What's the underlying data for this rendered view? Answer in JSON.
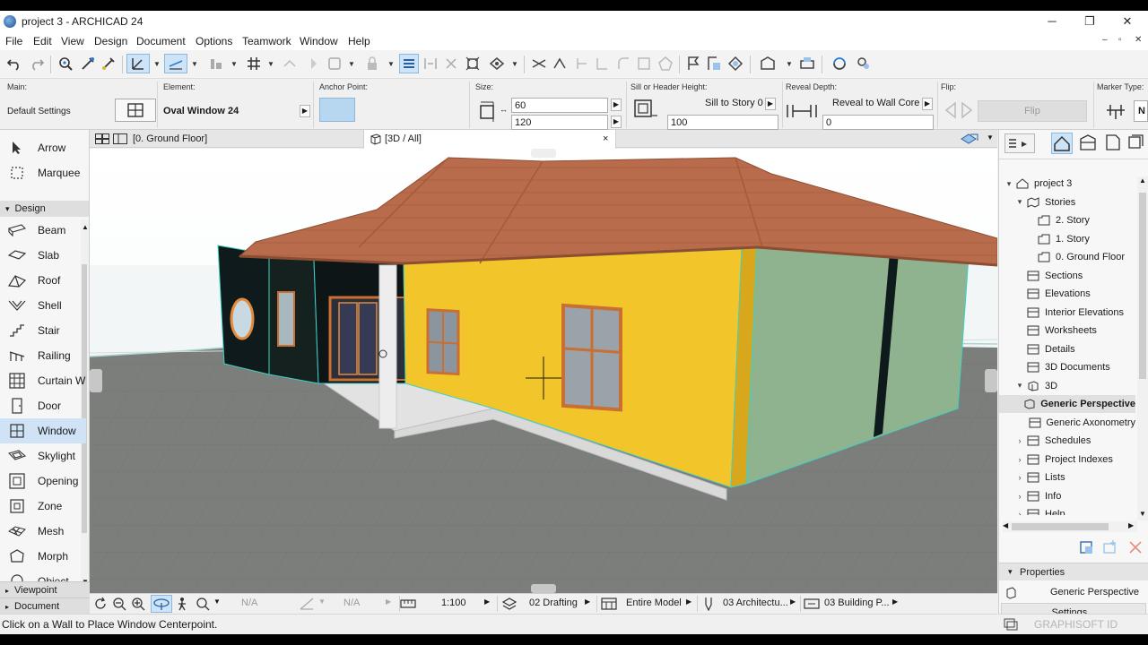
{
  "window": {
    "title": "project 3 - ARCHICAD 24",
    "controls": [
      "minimize",
      "restore",
      "close"
    ]
  },
  "menu": [
    "File",
    "Edit",
    "View",
    "Design",
    "Document",
    "Options",
    "Teamwork",
    "Window",
    "Help"
  ],
  "infobox": {
    "main_label": "Main:",
    "main_value": "Default Settings",
    "element_label": "Element:",
    "element_value": "Oval Window 24",
    "anchor_label": "Anchor Point:",
    "size_label": "Size:",
    "size_width": "60",
    "size_height": "120",
    "sill_label": "Sill or Header Height:",
    "sill_mode": "Sill to Story 0",
    "sill_value": "100",
    "reveal_label": "Reveal Depth:",
    "reveal_mode": "Reveal to Wall Core",
    "reveal_value": "0",
    "flip_label": "Flip:",
    "flip_button": "Flip",
    "marker_label": "Marker Type:",
    "marker_value": "N"
  },
  "tabs": [
    {
      "label": "[0. Ground Floor]"
    },
    {
      "label": "[3D / All]",
      "close": "×"
    }
  ],
  "toolbox": {
    "top_tools": [
      {
        "name": "arrow",
        "label": "Arrow"
      },
      {
        "name": "marquee",
        "label": "Marquee"
      }
    ],
    "design_header": "Design",
    "design_tools": [
      {
        "name": "beam",
        "label": "Beam"
      },
      {
        "name": "slab",
        "label": "Slab"
      },
      {
        "name": "roof",
        "label": "Roof"
      },
      {
        "name": "shell",
        "label": "Shell"
      },
      {
        "name": "stair",
        "label": "Stair"
      },
      {
        "name": "railing",
        "label": "Railing"
      },
      {
        "name": "curtain-wall",
        "label": "Curtain W"
      },
      {
        "name": "door",
        "label": "Door"
      },
      {
        "name": "window",
        "label": "Window",
        "active": true
      },
      {
        "name": "skylight",
        "label": "Skylight"
      },
      {
        "name": "opening",
        "label": "Opening"
      },
      {
        "name": "zone",
        "label": "Zone"
      },
      {
        "name": "mesh",
        "label": "Mesh"
      },
      {
        "name": "morph",
        "label": "Morph"
      },
      {
        "name": "object",
        "label": "Object"
      }
    ],
    "viewpoint_header": "Viewpoint",
    "document_header": "Document"
  },
  "navigator": {
    "items": [
      {
        "label": "project 3",
        "level": 0,
        "twisty": "▾",
        "icon": "project-icon"
      },
      {
        "label": "Stories",
        "level": 1,
        "twisty": "▾",
        "icon": "folder-icon"
      },
      {
        "label": "2. Story",
        "level": 2,
        "twisty": "",
        "icon": "story-icon"
      },
      {
        "label": "1. Story",
        "level": 2,
        "twisty": "",
        "icon": "story-icon"
      },
      {
        "label": "0. Ground Floor",
        "level": 2,
        "twisty": "",
        "icon": "story-icon"
      },
      {
        "label": "Sections",
        "level": 1,
        "twisty": "",
        "icon": "section-icon"
      },
      {
        "label": "Elevations",
        "level": 1,
        "twisty": "",
        "icon": "elevation-icon"
      },
      {
        "label": "Interior Elevations",
        "level": 1,
        "twisty": "",
        "icon": "interior-elevation-icon"
      },
      {
        "label": "Worksheets",
        "level": 1,
        "twisty": "",
        "icon": "worksheet-icon"
      },
      {
        "label": "Details",
        "level": 1,
        "twisty": "",
        "icon": "detail-icon"
      },
      {
        "label": "3D Documents",
        "level": 1,
        "twisty": "",
        "icon": "3d-document-icon"
      },
      {
        "label": "3D",
        "level": 1,
        "twisty": "▾",
        "icon": "3d-icon"
      },
      {
        "label": "Generic Perspective",
        "level": 2,
        "twisty": "",
        "icon": "perspective-icon",
        "selected": true
      },
      {
        "label": "Generic Axonometry",
        "level": 2,
        "twisty": "",
        "icon": "axonometry-icon"
      },
      {
        "label": "Schedules",
        "level": 1,
        "twisty": "›",
        "icon": "schedule-icon"
      },
      {
        "label": "Project Indexes",
        "level": 1,
        "twisty": "›",
        "icon": "index-icon"
      },
      {
        "label": "Lists",
        "level": 1,
        "twisty": "›",
        "icon": "list-icon"
      },
      {
        "label": "Info",
        "level": 1,
        "twisty": "›",
        "icon": "info-icon"
      },
      {
        "label": "Help",
        "level": 1,
        "twisty": "›",
        "icon": "help-icon"
      }
    ],
    "properties_header": "Properties",
    "properties_value": "Generic Perspective",
    "settings_button": "Settings...",
    "graphisoft_id": "GRAPHISOFT ID"
  },
  "bottombar": {
    "na1": "N/A",
    "na2": "N/A",
    "scale": "1:100",
    "layer_combo": "02 Drafting",
    "model_view": "Entire Model",
    "pen_set": "03 Architectu...",
    "dimension": "03 Building P..."
  },
  "status": "Click on a Wall to Place Window Centerpoint.",
  "colors": {
    "selection_blue": "#cfe2f6",
    "roof": "#b86b4b",
    "wall_yellow": "#f2c62a",
    "wall_green": "#8fb38f",
    "wall_dark": "#0f1a1c",
    "ground": "#7d7f7d"
  }
}
